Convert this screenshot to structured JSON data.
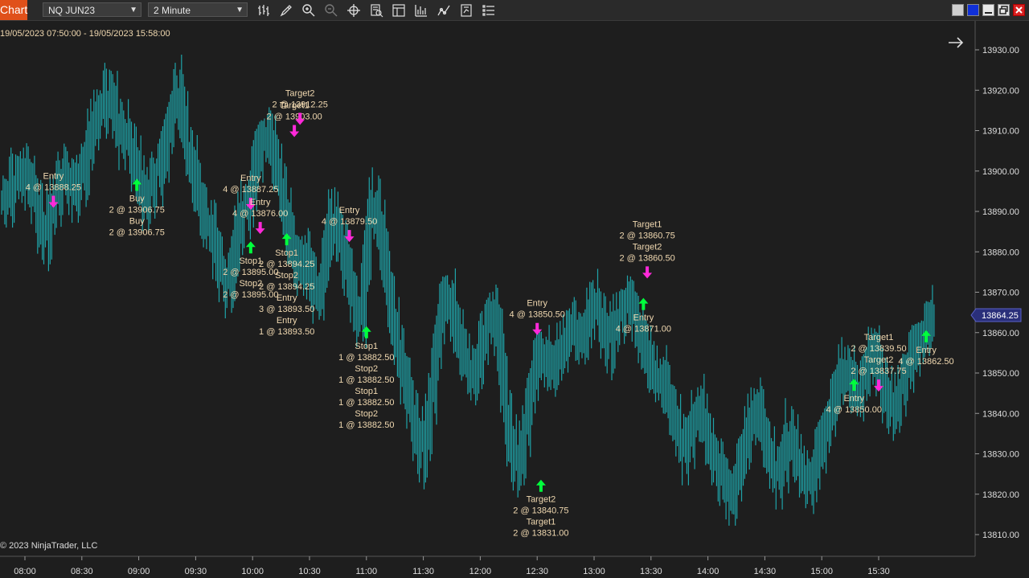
{
  "toolbar": {
    "chart_tab": "Chart",
    "instrument": "NQ JUN23",
    "interval": "2 Minute",
    "icons": [
      "bar-type-icon",
      "draw-tool-icon",
      "zoom-in-icon",
      "zoom-out-icon",
      "crosshair-icon",
      "data-box-icon",
      "properties-icon",
      "strategies-icon",
      "indicators-icon",
      "templates-icon",
      "object-list-icon"
    ]
  },
  "window": {
    "controls": [
      "tile",
      "color",
      "minimize",
      "maximize",
      "close"
    ]
  },
  "chart": {
    "date_range": "19/05/2023 07:50:00 - 19/05/2023 15:58:00",
    "copyright": "© 2023 NinjaTrader, LLC",
    "current_price": "13864.25",
    "colors": {
      "bar": "#1fa3a8",
      "buy": "#00ff3c",
      "sell": "#ff29d9",
      "label": "#f0d8b0",
      "price_marker": "#2a2f7a"
    }
  },
  "chart_data": {
    "type": "bar",
    "instrument": "NQ JUN23",
    "price_axis": {
      "labels": [
        "13930.00",
        "13920.00",
        "13910.00",
        "13900.00",
        "13890.00",
        "13880.00",
        "13870.00",
        "13860.00",
        "13850.00",
        "13840.00",
        "13830.00",
        "13820.00",
        "13810.00"
      ],
      "ylim": [
        13805,
        13935
      ]
    },
    "time_axis": {
      "labels": [
        "08:00",
        "08:30",
        "09:00",
        "09:30",
        "10:00",
        "10:30",
        "11:00",
        "11:30",
        "12:00",
        "12:30",
        "13:00",
        "13:30",
        "14:00",
        "14:30",
        "15:00",
        "15:30"
      ]
    },
    "price_series": [
      13894,
      13892,
      13899,
      13897,
      13901,
      13898,
      13896,
      13892,
      13885,
      13882,
      13891,
      13893,
      13900,
      13896,
      13899,
      13893,
      13901,
      13897,
      13906,
      13911,
      13916,
      13914,
      13920,
      13918,
      13912,
      13908,
      13910,
      13906,
      13901,
      13897,
      13892,
      13895,
      13900,
      13898,
      13904,
      13910,
      13916,
      13921,
      13914,
      13906,
      13902,
      13896,
      13892,
      13886,
      13887,
      13881,
      13876,
      13874,
      13870,
      13879,
      13886,
      13892,
      13890,
      13897,
      13904,
      13908,
      13910,
      13906,
      13901,
      13897,
      13889,
      13883,
      13879,
      13874,
      13880,
      13876,
      13871,
      13868,
      13875,
      13883,
      13890,
      13886,
      13881,
      13876,
      13871,
      13866,
      13862,
      13876,
      13889,
      13894,
      13886,
      13879,
      13870,
      13862,
      13856,
      13850,
      13846,
      13840,
      13834,
      13828,
      13835,
      13844,
      13855,
      13864,
      13868,
      13870,
      13862,
      13858,
      13854,
      13852,
      13848,
      13852,
      13858,
      13862,
      13866,
      13862,
      13852,
      13840,
      13832,
      13826,
      13829,
      13836,
      13844,
      13850,
      13854,
      13856,
      13852,
      13850,
      13854,
      13856,
      13860,
      13862,
      13860,
      13857,
      13861,
      13866,
      13868,
      13864,
      13860,
      13855,
      13862,
      13864,
      13866,
      13868,
      13866,
      13862,
      13858,
      13854,
      13851,
      13848,
      13850,
      13846,
      13842,
      13838,
      13834,
      13830,
      13834,
      13838,
      13842,
      13838,
      13834,
      13830,
      13827,
      13824,
      13822,
      13818,
      13824,
      13828,
      13832,
      13838,
      13842,
      13840,
      13834,
      13830,
      13826,
      13824,
      13828,
      13836,
      13832,
      13828,
      13826,
      13824,
      13822,
      13828,
      13832,
      13836,
      13840,
      13844,
      13848,
      13852,
      13850,
      13846,
      13844,
      13848,
      13852,
      13856,
      13854,
      13848,
      13844,
      13840,
      13842,
      13846,
      13850,
      13852,
      13856,
      13858,
      13860,
      13862,
      13864
    ],
    "markers": [
      {
        "dir": "down",
        "price": 13892.5,
        "time": "08:15",
        "label": [
          "Entry",
          "4 @ 13888.25"
        ]
      },
      {
        "dir": "up",
        "price": 13896.5,
        "time": "08:59",
        "label": [
          "Buy",
          "2 @ 13906.75",
          "Buy",
          "2 @ 13906.75"
        ]
      },
      {
        "dir": "down",
        "price": 13892,
        "time": "09:59",
        "label": [
          "Entry",
          "4 @ 13887.25"
        ]
      },
      {
        "dir": "down",
        "price": 13886,
        "time": "10:04",
        "label": [
          "Entry",
          "4 @ 13876.00"
        ]
      },
      {
        "dir": "up",
        "price": 13881,
        "time": "09:59",
        "label": [
          "Stop1",
          "2 @ 13895.00",
          "Stop2",
          "2 @ 13895.00"
        ]
      },
      {
        "dir": "up",
        "price": 13883,
        "time": "10:18",
        "label": [
          "Stop1",
          "2 @ 13894.25",
          "Stop2",
          "2 @ 13894.25",
          "Entry",
          "3 @ 13893.50",
          "Entry",
          "1 @ 13893.50"
        ]
      },
      {
        "dir": "down",
        "price": 13910,
        "time": "10:22",
        "label": [
          "Target1",
          "2 @ 13903.00"
        ]
      },
      {
        "dir": "down",
        "price": 13913,
        "time": "10:25",
        "label": [
          "Target2",
          "2 @ 13912.25"
        ]
      },
      {
        "dir": "down",
        "price": 13884,
        "time": "10:51",
        "label": [
          "Entry",
          "4 @ 13879.50"
        ]
      },
      {
        "dir": "up",
        "price": 13860,
        "time": "11:00",
        "label": [
          "Stop1",
          "1 @ 13882.50",
          "Stop2",
          "1 @ 13882.50",
          "Stop1",
          "1 @ 13882.50",
          "Stop2",
          "1 @ 13882.50"
        ]
      },
      {
        "dir": "down",
        "price": 13861,
        "time": "12:30",
        "label": [
          "Entry",
          "4 @ 13850.50"
        ]
      },
      {
        "dir": "up",
        "price": 13822,
        "time": "12:32",
        "label": [
          "Target2",
          "2 @ 13840.75",
          "Target1",
          "2 @ 13831.00"
        ]
      },
      {
        "dir": "down",
        "price": 13875,
        "time": "13:28",
        "label": [
          "Target1",
          "2 @ 13860.75",
          "Target2",
          "2 @ 13860.50"
        ]
      },
      {
        "dir": "up",
        "price": 13867,
        "time": "13:26",
        "label": [
          "Entry",
          "4 @ 13871.00"
        ]
      },
      {
        "dir": "up",
        "price": 13847,
        "time": "15:17",
        "label": [
          "Entry",
          "4 @ 13850.00"
        ]
      },
      {
        "dir": "down",
        "price": 13847,
        "time": "15:30",
        "label": [
          "Target1",
          "2 @ 13839.50",
          "Target2",
          "2 @ 13837.75"
        ]
      },
      {
        "dir": "up",
        "price": 13859,
        "time": "15:55",
        "label": [
          "Entry",
          "4 @ 13862.50"
        ]
      }
    ]
  }
}
